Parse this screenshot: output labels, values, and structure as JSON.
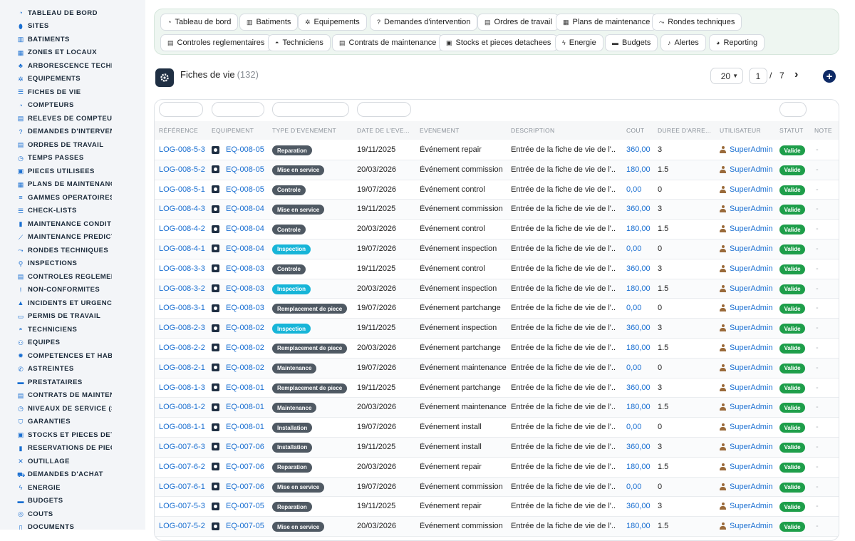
{
  "sidebar": {
    "items": [
      {
        "label": "TABLEAU DE BORD",
        "icon": "dashboard-icon",
        "glyph": "◔"
      },
      {
        "label": "SITES",
        "icon": "map-pin-icon",
        "glyph": "⬮"
      },
      {
        "label": "BATIMENTS",
        "icon": "building-icon",
        "glyph": "▥"
      },
      {
        "label": "ZONES ET LOCAUX",
        "icon": "grid-icon",
        "glyph": "▦"
      },
      {
        "label": "ARBORESCENCE TECHNI",
        "icon": "tree-icon",
        "glyph": "♣"
      },
      {
        "label": "EQUIPEMENTS",
        "icon": "cogs-icon",
        "glyph": "✲"
      },
      {
        "label": "FICHES DE VIE",
        "icon": "list-icon",
        "glyph": "☰"
      },
      {
        "label": "COMPTEURS",
        "icon": "gauge-icon",
        "glyph": "◔"
      },
      {
        "label": "RELEVES DE COMPTEURS",
        "icon": "clipboard-icon",
        "glyph": "▤"
      },
      {
        "label": "DEMANDES D'INTERVENT",
        "icon": "question-icon",
        "glyph": "?"
      },
      {
        "label": "ORDRES DE TRAVAIL",
        "icon": "clipboard-icon",
        "glyph": "▤"
      },
      {
        "label": "TEMPS PASSES",
        "icon": "clock-icon",
        "glyph": "◷"
      },
      {
        "label": "PIECES UTILISEES",
        "icon": "cubes-icon",
        "glyph": "▣"
      },
      {
        "label": "PLANS DE MAINTENANCE",
        "icon": "calendar-icon",
        "glyph": "▦"
      },
      {
        "label": "GAMMES OPERATOIRES",
        "icon": "list-ol-icon",
        "glyph": "≡"
      },
      {
        "label": "CHECK-LISTS",
        "icon": "checklist-icon",
        "glyph": "☰"
      },
      {
        "label": "MAINTENANCE CONDITIO",
        "icon": "thermometer-icon",
        "glyph": "▮"
      },
      {
        "label": "MAINTENANCE PREDICTI",
        "icon": "chart-line-icon",
        "glyph": "⟋"
      },
      {
        "label": "RONDES TECHNIQUES",
        "icon": "route-icon",
        "glyph": "⤳"
      },
      {
        "label": "INSPECTIONS",
        "icon": "search-icon",
        "glyph": "⚲"
      },
      {
        "label": "CONTROLES REGLEMENT",
        "icon": "clipboard-check-icon",
        "glyph": "▤"
      },
      {
        "label": "NON-CONFORMITES",
        "icon": "exclamation-circle-icon",
        "glyph": "!"
      },
      {
        "label": "INCIDENTS ET URGENCES",
        "icon": "warning-icon",
        "glyph": "▲"
      },
      {
        "label": "PERMIS DE TRAVAIL",
        "icon": "id-card-icon",
        "glyph": "▭"
      },
      {
        "label": "TECHNICIENS",
        "icon": "hard-hat-icon",
        "glyph": "◓"
      },
      {
        "label": "EQUIPES",
        "icon": "users-icon",
        "glyph": "⚇"
      },
      {
        "label": "COMPETENCES ET HABIL",
        "icon": "certificate-icon",
        "glyph": "✹"
      },
      {
        "label": "ASTREINTES",
        "icon": "phone-icon",
        "glyph": "✆"
      },
      {
        "label": "PRESTATAIRES",
        "icon": "handshake-icon",
        "glyph": "▬"
      },
      {
        "label": "CONTRATS DE MAINTENA",
        "icon": "file-contract-icon",
        "glyph": "▤"
      },
      {
        "label": "NIVEAUX DE SERVICE (SL",
        "icon": "stopwatch-icon",
        "glyph": "◷"
      },
      {
        "label": "GARANTIES",
        "icon": "shield-icon",
        "glyph": "⛉"
      },
      {
        "label": "STOCKS ET PIECES DETA",
        "icon": "boxes-icon",
        "glyph": "▣"
      },
      {
        "label": "RESERVATIONS DE PIECE",
        "icon": "bookmark-icon",
        "glyph": "▮"
      },
      {
        "label": "OUTILLAGE",
        "icon": "tools-icon",
        "glyph": "✕"
      },
      {
        "label": "DEMANDES D'ACHAT",
        "icon": "cart-icon",
        "glyph": "⛟"
      },
      {
        "label": "ENERGIE",
        "icon": "bolt-icon",
        "glyph": "ϟ"
      },
      {
        "label": "BUDGETS",
        "icon": "wallet-icon",
        "glyph": "▬"
      },
      {
        "label": "COUTS",
        "icon": "coins-icon",
        "glyph": "◎"
      },
      {
        "label": "DOCUMENTS",
        "icon": "file-icon",
        "glyph": "▯"
      }
    ]
  },
  "topnav": {
    "items": [
      {
        "label": "Tableau de bord",
        "icon": "dashboard-icon",
        "glyph": "◔"
      },
      {
        "label": "Batiments",
        "icon": "building-icon",
        "glyph": "▥"
      },
      {
        "label": "Equipements",
        "icon": "cogs-icon",
        "glyph": "✲"
      },
      {
        "label": "Demandes d'intervention",
        "icon": "question-icon",
        "glyph": "?"
      },
      {
        "label": "Ordres de travail",
        "icon": "clipboard-icon",
        "glyph": "▤"
      },
      {
        "label": "Plans de maintenance",
        "icon": "calendar-icon",
        "glyph": "▦"
      },
      {
        "label": "Rondes techniques",
        "icon": "route-icon",
        "glyph": "⤳"
      },
      {
        "label": "Controles reglementaires",
        "icon": "clipboard-check-icon",
        "glyph": "▤"
      },
      {
        "label": "Techniciens",
        "icon": "hard-hat-icon",
        "glyph": "◓"
      },
      {
        "label": "Contrats de maintenance",
        "icon": "file-contract-icon",
        "glyph": "▤"
      },
      {
        "label": "Stocks et pieces detachees",
        "icon": "boxes-icon",
        "glyph": "▣"
      },
      {
        "label": "Energie",
        "icon": "bolt-icon",
        "glyph": "ϟ"
      },
      {
        "label": "Budgets",
        "icon": "money-icon",
        "glyph": "▬"
      },
      {
        "label": "Alertes",
        "icon": "bell-icon",
        "glyph": "♪"
      },
      {
        "label": "Reporting",
        "icon": "pie-chart-icon",
        "glyph": "◕"
      }
    ]
  },
  "header": {
    "title": "Fiches de vie",
    "count": "(132)",
    "page_size": "20",
    "page": "1",
    "separator": "/",
    "total_pages": "7",
    "next": "›",
    "add": "+"
  },
  "table": {
    "columns": [
      "RÉFÉRENCE",
      "EQUIPEMENT",
      "TYPE D'EVENEMENT",
      "DATE DE L'EVE...",
      "EVENEMENT",
      "DESCRIPTION",
      "COUT",
      "DUREE D'ARRE...",
      "UTILISATEUR",
      "STATUT",
      "NOTE"
    ],
    "rows": [
      {
        "ref": "LOG-008-5-3",
        "eq": "EQ-008-05",
        "type": "Reparation",
        "type_color": "gray",
        "date": "19/11/2025",
        "event": "Événement repair",
        "desc": "Entrée de la fiche de vie de l'...",
        "cost": "360,00",
        "duration": "3",
        "user": "SuperAdmin",
        "status": "Valide",
        "note": "-"
      },
      {
        "ref": "LOG-008-5-2",
        "eq": "EQ-008-05",
        "type": "Mise en service",
        "type_color": "gray",
        "date": "20/03/2026",
        "event": "Événement commission",
        "desc": "Entrée de la fiche de vie de l'...",
        "cost": "180,00",
        "duration": "1.5",
        "user": "SuperAdmin",
        "status": "Valide",
        "note": "-"
      },
      {
        "ref": "LOG-008-5-1",
        "eq": "EQ-008-05",
        "type": "Controle",
        "type_color": "gray",
        "date": "19/07/2026",
        "event": "Événement control",
        "desc": "Entrée de la fiche de vie de l'...",
        "cost": "0,00",
        "duration": "0",
        "user": "SuperAdmin",
        "status": "Valide",
        "note": "-"
      },
      {
        "ref": "LOG-008-4-3",
        "eq": "EQ-008-04",
        "type": "Mise en service",
        "type_color": "gray",
        "date": "19/11/2025",
        "event": "Événement commission",
        "desc": "Entrée de la fiche de vie de l'...",
        "cost": "360,00",
        "duration": "3",
        "user": "SuperAdmin",
        "status": "Valide",
        "note": "-"
      },
      {
        "ref": "LOG-008-4-2",
        "eq": "EQ-008-04",
        "type": "Controle",
        "type_color": "gray",
        "date": "20/03/2026",
        "event": "Événement control",
        "desc": "Entrée de la fiche de vie de l'...",
        "cost": "180,00",
        "duration": "1.5",
        "user": "SuperAdmin",
        "status": "Valide",
        "note": "-"
      },
      {
        "ref": "LOG-008-4-1",
        "eq": "EQ-008-04",
        "type": "Inspection",
        "type_color": "cyan",
        "date": "19/07/2026",
        "event": "Événement inspection",
        "desc": "Entrée de la fiche de vie de l'...",
        "cost": "0,00",
        "duration": "0",
        "user": "SuperAdmin",
        "status": "Valide",
        "note": "-"
      },
      {
        "ref": "LOG-008-3-3",
        "eq": "EQ-008-03",
        "type": "Controle",
        "type_color": "gray",
        "date": "19/11/2025",
        "event": "Événement control",
        "desc": "Entrée de la fiche de vie de l'...",
        "cost": "360,00",
        "duration": "3",
        "user": "SuperAdmin",
        "status": "Valide",
        "note": "-"
      },
      {
        "ref": "LOG-008-3-2",
        "eq": "EQ-008-03",
        "type": "Inspection",
        "type_color": "cyan",
        "date": "20/03/2026",
        "event": "Événement inspection",
        "desc": "Entrée de la fiche de vie de l'...",
        "cost": "180,00",
        "duration": "1.5",
        "user": "SuperAdmin",
        "status": "Valide",
        "note": "-"
      },
      {
        "ref": "LOG-008-3-1",
        "eq": "EQ-008-03",
        "type": "Remplacement de piece",
        "type_color": "gray",
        "date": "19/07/2026",
        "event": "Événement partchange",
        "desc": "Entrée de la fiche de vie de l'...",
        "cost": "0,00",
        "duration": "0",
        "user": "SuperAdmin",
        "status": "Valide",
        "note": "-"
      },
      {
        "ref": "LOG-008-2-3",
        "eq": "EQ-008-02",
        "type": "Inspection",
        "type_color": "cyan",
        "date": "19/11/2025",
        "event": "Événement inspection",
        "desc": "Entrée de la fiche de vie de l'...",
        "cost": "360,00",
        "duration": "3",
        "user": "SuperAdmin",
        "status": "Valide",
        "note": "-"
      },
      {
        "ref": "LOG-008-2-2",
        "eq": "EQ-008-02",
        "type": "Remplacement de piece",
        "type_color": "gray",
        "date": "20/03/2026",
        "event": "Événement partchange",
        "desc": "Entrée de la fiche de vie de l'...",
        "cost": "180,00",
        "duration": "1.5",
        "user": "SuperAdmin",
        "status": "Valide",
        "note": "-"
      },
      {
        "ref": "LOG-008-2-1",
        "eq": "EQ-008-02",
        "type": "Maintenance",
        "type_color": "gray",
        "date": "19/07/2026",
        "event": "Événement maintenance",
        "desc": "Entrée de la fiche de vie de l'...",
        "cost": "0,00",
        "duration": "0",
        "user": "SuperAdmin",
        "status": "Valide",
        "note": "-"
      },
      {
        "ref": "LOG-008-1-3",
        "eq": "EQ-008-01",
        "type": "Remplacement de piece",
        "type_color": "gray",
        "date": "19/11/2025",
        "event": "Événement partchange",
        "desc": "Entrée de la fiche de vie de l'...",
        "cost": "360,00",
        "duration": "3",
        "user": "SuperAdmin",
        "status": "Valide",
        "note": "-"
      },
      {
        "ref": "LOG-008-1-2",
        "eq": "EQ-008-01",
        "type": "Maintenance",
        "type_color": "gray",
        "date": "20/03/2026",
        "event": "Événement maintenance",
        "desc": "Entrée de la fiche de vie de l'...",
        "cost": "180,00",
        "duration": "1.5",
        "user": "SuperAdmin",
        "status": "Valide",
        "note": "-"
      },
      {
        "ref": "LOG-008-1-1",
        "eq": "EQ-008-01",
        "type": "Installation",
        "type_color": "gray",
        "date": "19/07/2026",
        "event": "Événement install",
        "desc": "Entrée de la fiche de vie de l'...",
        "cost": "0,00",
        "duration": "0",
        "user": "SuperAdmin",
        "status": "Valide",
        "note": "-"
      },
      {
        "ref": "LOG-007-6-3",
        "eq": "EQ-007-06",
        "type": "Installation",
        "type_color": "gray",
        "date": "19/11/2025",
        "event": "Événement install",
        "desc": "Entrée de la fiche de vie de l'...",
        "cost": "360,00",
        "duration": "3",
        "user": "SuperAdmin",
        "status": "Valide",
        "note": "-"
      },
      {
        "ref": "LOG-007-6-2",
        "eq": "EQ-007-06",
        "type": "Reparation",
        "type_color": "gray",
        "date": "20/03/2026",
        "event": "Événement repair",
        "desc": "Entrée de la fiche de vie de l'...",
        "cost": "180,00",
        "duration": "1.5",
        "user": "SuperAdmin",
        "status": "Valide",
        "note": "-"
      },
      {
        "ref": "LOG-007-6-1",
        "eq": "EQ-007-06",
        "type": "Mise en service",
        "type_color": "gray",
        "date": "19/07/2026",
        "event": "Événement commission",
        "desc": "Entrée de la fiche de vie de l'...",
        "cost": "0,00",
        "duration": "0",
        "user": "SuperAdmin",
        "status": "Valide",
        "note": "-"
      },
      {
        "ref": "LOG-007-5-3",
        "eq": "EQ-007-05",
        "type": "Reparation",
        "type_color": "gray",
        "date": "19/11/2025",
        "event": "Événement repair",
        "desc": "Entrée de la fiche de vie de l'...",
        "cost": "360,00",
        "duration": "3",
        "user": "SuperAdmin",
        "status": "Valide",
        "note": "-"
      },
      {
        "ref": "LOG-007-5-2",
        "eq": "EQ-007-05",
        "type": "Mise en service",
        "type_color": "gray",
        "date": "20/03/2026",
        "event": "Événement commission",
        "desc": "Entrée de la fiche de vie de l'...",
        "cost": "180,00",
        "duration": "1.5",
        "user": "SuperAdmin",
        "status": "Valide",
        "note": "-"
      }
    ]
  },
  "colors": {
    "accent": "#1a6fd1",
    "badge_gray": "#4f5963",
    "badge_cyan": "#17b5d8",
    "status_valid": "#1e9e4a",
    "brand_dark": "#0e2a66"
  }
}
